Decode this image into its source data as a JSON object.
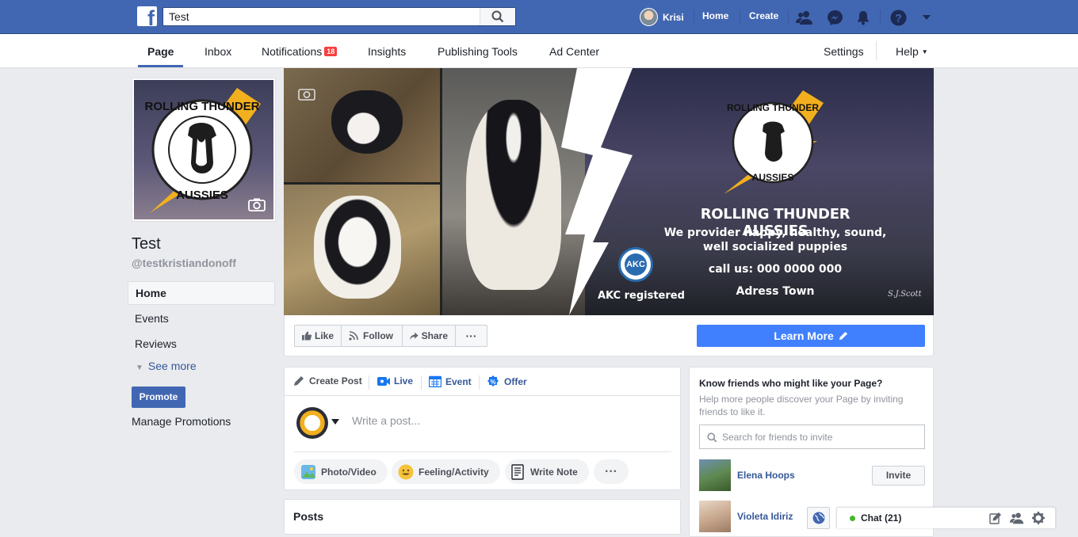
{
  "topbar": {
    "search_value": "Test",
    "user_name": "Krisi",
    "home_label": "Home",
    "create_label": "Create",
    "logo_letter": "f"
  },
  "page_tabs": {
    "page": "Page",
    "inbox": "Inbox",
    "notifications": "Notifications",
    "notifications_badge": "18",
    "insights": "Insights",
    "publishing_tools": "Publishing Tools",
    "ad_center": "Ad Center",
    "settings": "Settings",
    "help": "Help"
  },
  "profile": {
    "logo_text_top": "ROLLING THUNDER",
    "logo_text_bottom": "AUSSIES",
    "name": "Test",
    "handle": "@testkristiandonoff"
  },
  "left_nav": {
    "items": [
      "Home",
      "Events",
      "Reviews"
    ],
    "see_more": "See more",
    "promote": "Promote",
    "manage_promotions": "Manage Promotions"
  },
  "cover": {
    "logo_text_top": "ROLLING THUNDER",
    "logo_text_bottom": "AUSSIES",
    "headline": "ROLLING THUNDER AUSSIES",
    "tagline_1": "We provider happy, healthy, sound,",
    "tagline_2": "well socialized puppies",
    "phone": "call us: 000 0000 000",
    "address": "Adress Town",
    "akc_badge": "AKC",
    "akc_label": "AKC registered",
    "signature": "S.J.Scott"
  },
  "actions": {
    "like": "Like",
    "follow": "Follow",
    "share": "Share",
    "more": "···",
    "learn_more": "Learn More"
  },
  "composer": {
    "tabs": [
      "Create Post",
      "Live",
      "Event",
      "Offer"
    ],
    "placeholder": "Write a post...",
    "buttons": [
      "Photo/Video",
      "Feeling/Activity",
      "Write Note"
    ],
    "more": "···"
  },
  "posts": {
    "heading": "Posts"
  },
  "invite": {
    "title": "Know friends who might like your Page?",
    "subtitle": "Help more people discover your Page by inviting friends to like it.",
    "search_placeholder": "Search for friends to invite",
    "friends": [
      {
        "name": "Elena Hoops",
        "button": "Invite"
      },
      {
        "name": "Violeta Idiriz",
        "button": ""
      }
    ]
  },
  "chat": {
    "label": "Chat (21)",
    "status_color": "#42b72a"
  },
  "colors": {
    "brand": "#4267b2",
    "accent_button": "#4080ff",
    "badge": "#fa3e3e"
  }
}
